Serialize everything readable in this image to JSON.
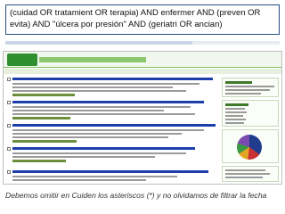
{
  "slide": {
    "title": "(cuidad OR tratamient OR terapia) AND enfermer AND (preven OR evita) AND \"úlcera por presión\" AND (geriatri OR ancian)",
    "caption": "Debemos omitir en Cuiden los asteriscos (*) y no olvidamos de filtrar la fecha"
  }
}
